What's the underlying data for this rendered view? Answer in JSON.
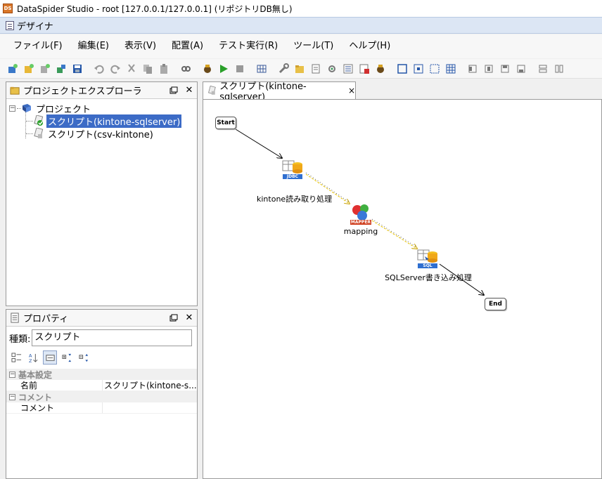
{
  "window": {
    "title": "DataSpider Studio - root [127.0.0.1/127.0.0.1] (リポジトリDB無し)",
    "app_icon_text": "DS"
  },
  "designer_bar": {
    "label": "デザイナ"
  },
  "menu": [
    {
      "label": "ファイル(F)"
    },
    {
      "label": "編集(E)"
    },
    {
      "label": "表示(V)"
    },
    {
      "label": "配置(A)"
    },
    {
      "label": "テスト実行(R)"
    },
    {
      "label": "ツール(T)"
    },
    {
      "label": "ヘルプ(H)"
    }
  ],
  "explorer": {
    "title": "プロジェクトエクスプローラ",
    "tree": {
      "project_label": "プロジェクト",
      "items": [
        {
          "label": "スクリプト(kintone-sqlserver)",
          "selected": true
        },
        {
          "label": "スクリプト(csv-kintone)",
          "selected": false
        }
      ]
    }
  },
  "properties": {
    "title": "プロパティ",
    "kind_label": "種類:",
    "kind_value": "スクリプト",
    "categories": [
      {
        "label": "基本設定",
        "rows": [
          {
            "key": "名前",
            "value": "スクリプト(kintone-s..."
          }
        ]
      },
      {
        "label": "コメント",
        "rows": [
          {
            "key": "コメント",
            "value": ""
          }
        ]
      }
    ]
  },
  "editor": {
    "tab_label": "スクリプト(kintone-sqlserver)",
    "tab_close": "×",
    "nodes": {
      "start": "Start",
      "end": "End",
      "read": {
        "label": "kintone読み取り処理",
        "badge": "JDBC"
      },
      "mapping": {
        "label": "mapping",
        "badge": "MAPPER"
      },
      "write": {
        "label": "SQLServer書き込み処理",
        "badge": "SQL"
      }
    }
  },
  "colors": {
    "selection": "#3c6bc6",
    "designer_bar": "#dce6f4",
    "jdbc_badge": "#2f6fd0",
    "mapper_badge": "#d04020",
    "flow_line": "#000000",
    "data_line": "#e6c200"
  }
}
